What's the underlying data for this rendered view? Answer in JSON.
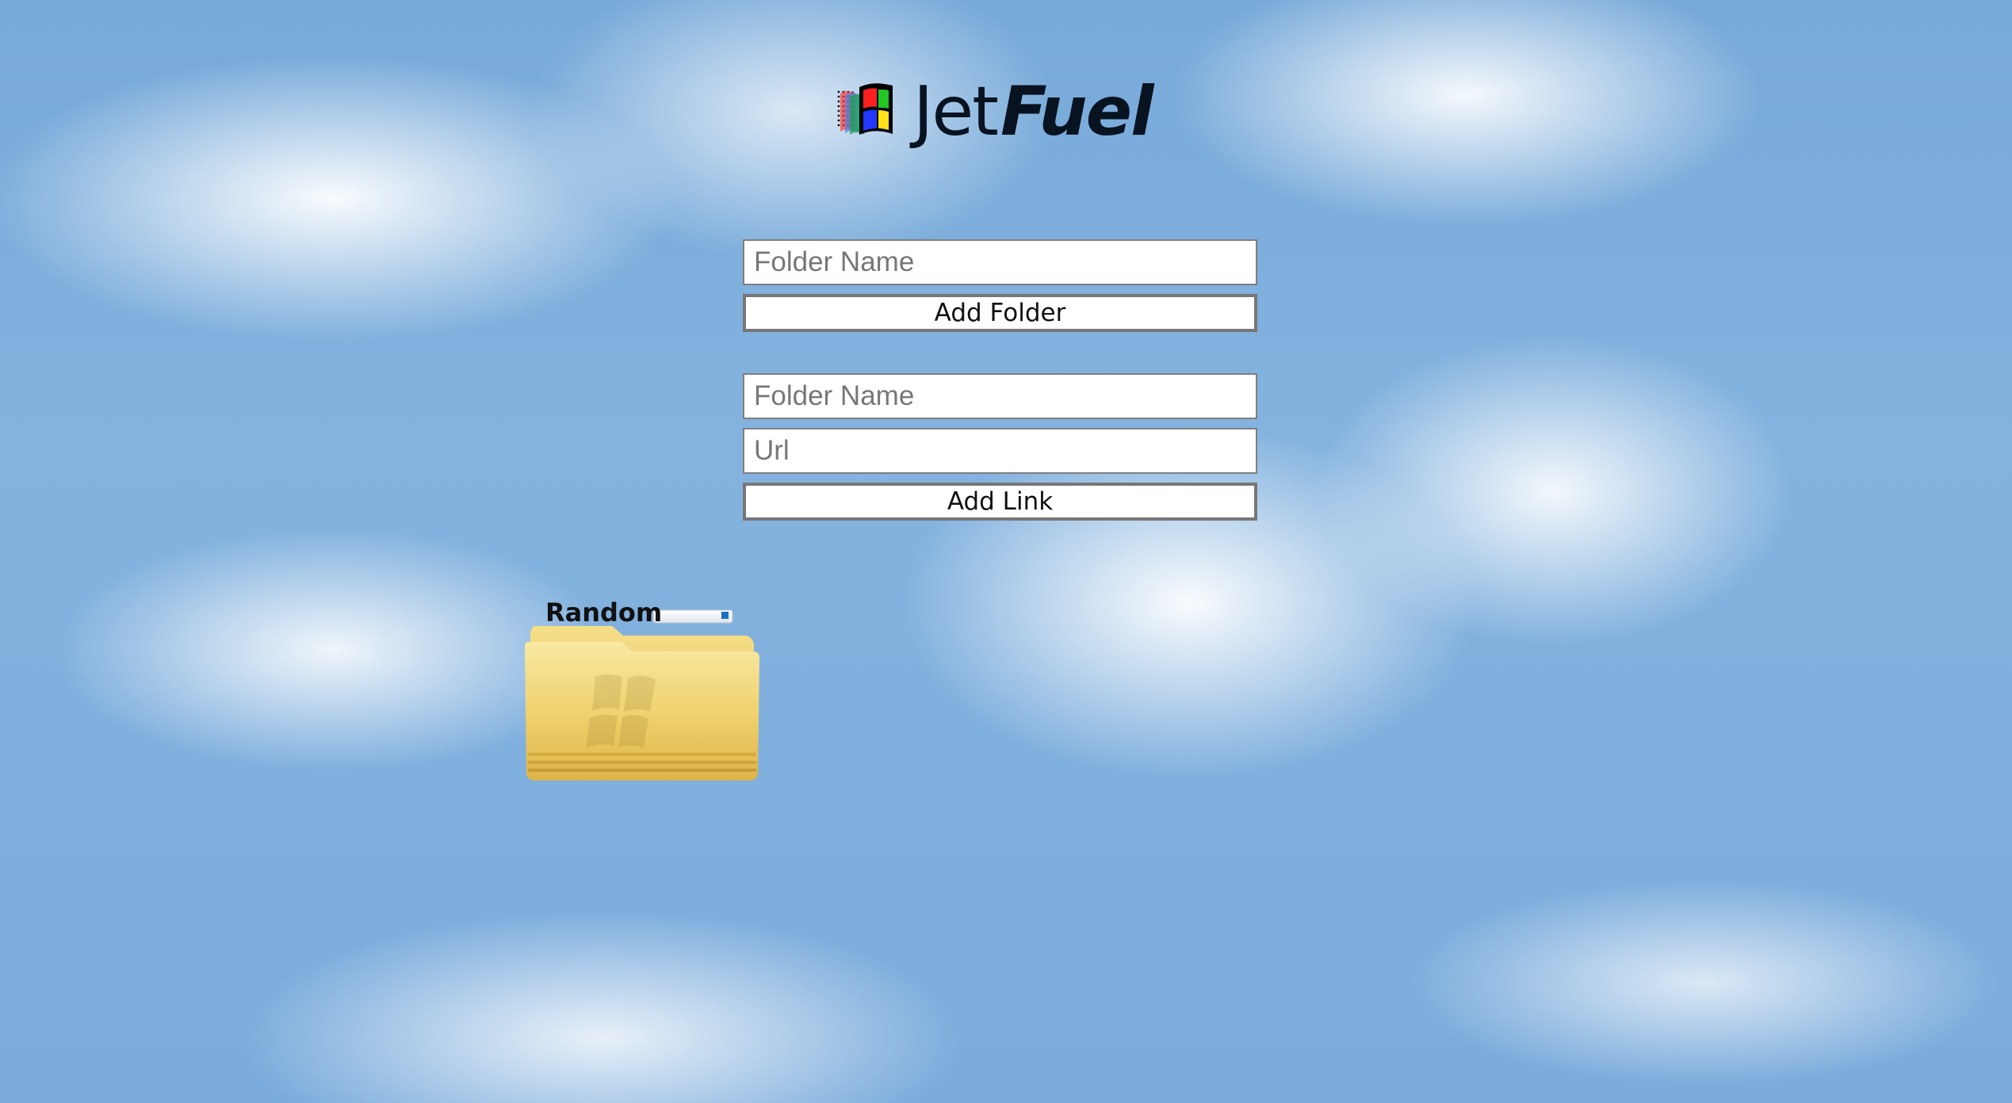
{
  "brand": {
    "name_regular": "Jet",
    "name_bold": "Fuel"
  },
  "add_folder_form": {
    "folder_name_placeholder": "Folder Name",
    "button_label": "Add Folder"
  },
  "add_link_form": {
    "folder_name_placeholder": "Folder Name",
    "url_placeholder": "Url",
    "button_label": "Add Link"
  },
  "folders": [
    {
      "label": "Random",
      "icon": "windows-folder-icon"
    }
  ],
  "colors": {
    "sky": "#7cacdc",
    "folder": "#e5c55c",
    "input_border": "#7f7f7f",
    "button_border": "#777777"
  },
  "icons": {
    "logo": "windows-flag-icon",
    "folder": "windows-folder-icon"
  }
}
